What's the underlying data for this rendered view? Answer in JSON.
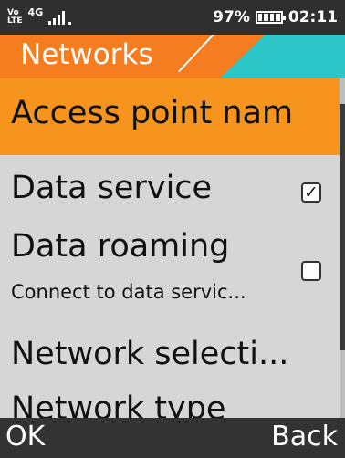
{
  "status_bar": {
    "volte_top": "Vo",
    "volte_bottom": "LTE",
    "network_type": "4G",
    "battery_percent": "97%",
    "time": "02:11",
    "signal_bars": 4,
    "battery_level": 4
  },
  "title": "Networks",
  "list": {
    "items": [
      {
        "label": "Access point nam",
        "selected": true
      },
      {
        "label": "Data service",
        "checked": true,
        "check_mark": "✓"
      },
      {
        "label": "Data roaming",
        "subtitle": "Connect to data servic...",
        "checked": false
      },
      {
        "label": "Network selecti..."
      },
      {
        "label": "Network type"
      }
    ]
  },
  "softkeys": {
    "left": "OK",
    "right": "Back"
  },
  "colors": {
    "status_bar_bg": "#2f2f2f",
    "title_orange": "#f57c1f",
    "title_teal": "#2cc6c8",
    "highlight": "#f7941d",
    "list_bg": "#d6d6d6",
    "softkey_bg": "#333333"
  },
  "icons": {
    "volte": "volte-icon",
    "signal": "signal-strength-icon",
    "battery": "battery-icon",
    "checkbox": "checkbox-icon"
  }
}
